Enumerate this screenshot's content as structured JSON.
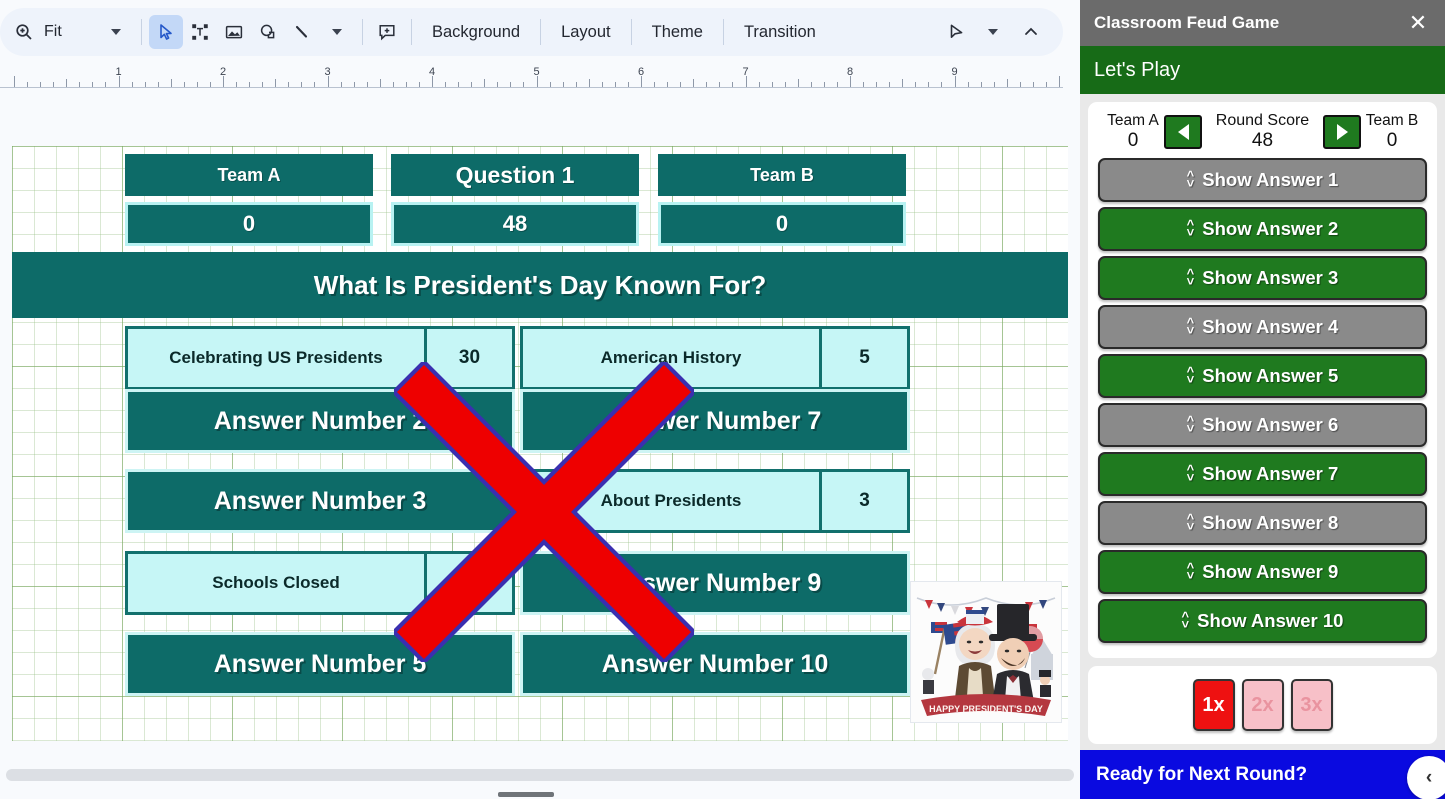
{
  "toolbar": {
    "zoom_icon": "zoom-in-icon",
    "zoom_value": "Fit",
    "tools": [
      {
        "name": "select-tool",
        "icon": "cursor-arrow-icon"
      },
      {
        "name": "text-box-tool",
        "icon": "text-box-icon"
      },
      {
        "name": "insert-image-tool",
        "icon": "image-icon"
      },
      {
        "name": "shape-tool",
        "icon": "shape-icon"
      },
      {
        "name": "line-tool",
        "icon": "line-icon"
      },
      {
        "name": "comment-tool",
        "icon": "add-comment-icon"
      }
    ],
    "menu_items": [
      "Background",
      "Layout",
      "Theme",
      "Transition"
    ],
    "right_icons": [
      "laser-pointer-icon",
      "chevron-down-icon",
      "chevron-up-icon"
    ]
  },
  "ruler": {
    "labels": [
      "1",
      "2",
      "3",
      "4",
      "5",
      "6",
      "7",
      "8",
      "9"
    ]
  },
  "slide": {
    "header": {
      "team_a_label": "Team A",
      "question_label": "Question 1",
      "team_b_label": "Team B",
      "team_a_score": "0",
      "round_score": "48",
      "team_b_score": "0"
    },
    "question": "What Is President's Day Known For?",
    "answers_left": [
      {
        "text": "Celebrating US Presidents",
        "points": "30",
        "revealed": true
      },
      {
        "text": "Answer Number 2",
        "points": "",
        "revealed": false
      },
      {
        "text": "Answer Number 3",
        "points": "",
        "revealed": false
      },
      {
        "text": "Schools Closed",
        "points": "",
        "revealed": true
      },
      {
        "text": "Answer Number 5",
        "points": "",
        "revealed": false
      }
    ],
    "answers_right": [
      {
        "text": "American History",
        "points": "5",
        "revealed": true
      },
      {
        "text": "Answer Number 7",
        "points": "",
        "revealed": false
      },
      {
        "text": "About Presidents",
        "points": "3",
        "revealed": true
      },
      {
        "text": "Answer Number 9",
        "points": "",
        "revealed": false
      },
      {
        "text": "Answer Number 10",
        "points": "",
        "revealed": false
      }
    ],
    "image_caption": "HAPPY PRESIDENT'S DAY",
    "overlay_mark": "red-x-mark",
    "colors": {
      "box_teal": "#0d6b68",
      "box_cyan": "#c6f6f6",
      "grid_green": "#7aa860",
      "x_red": "#ee0000",
      "x_outline": "#3a2fb0"
    }
  },
  "panel": {
    "title": "Classroom Feud Game",
    "close_icon": "close-icon",
    "subtitle": "Let's Play",
    "score": {
      "team_a_label": "Team A",
      "team_a_value": "0",
      "round_label": "Round Score",
      "round_value": "48",
      "team_b_label": "Team B",
      "team_b_value": "0",
      "left_arrow_icon": "arrow-left-icon",
      "right_arrow_icon": "arrow-right-icon"
    },
    "answer_buttons": [
      {
        "label": "Show Answer 1",
        "state": "gray"
      },
      {
        "label": "Show Answer 2",
        "state": "green"
      },
      {
        "label": "Show Answer 3",
        "state": "green"
      },
      {
        "label": "Show Answer 4",
        "state": "gray"
      },
      {
        "label": "Show Answer 5",
        "state": "green"
      },
      {
        "label": "Show Answer 6",
        "state": "gray"
      },
      {
        "label": "Show Answer 7",
        "state": "green"
      },
      {
        "label": "Show Answer 8",
        "state": "gray"
      },
      {
        "label": "Show Answer 9",
        "state": "green"
      },
      {
        "label": "Show Answer 10",
        "state": "green"
      }
    ],
    "multipliers": [
      {
        "label": "1x",
        "state": "on"
      },
      {
        "label": "2x",
        "state": "off"
      },
      {
        "label": "3x",
        "state": "off"
      }
    ],
    "footer_label": "Ready for Next Round?",
    "collapse_icon": "chevron-left-icon",
    "colors": {
      "header_gray": "#6b6b6b",
      "green": "#1f7a1f",
      "gray": "#8a8a8a",
      "footer_blue": "#0a0ae0",
      "multiplier_on": "#ee1111",
      "multiplier_off": "#f7c0c8"
    }
  }
}
